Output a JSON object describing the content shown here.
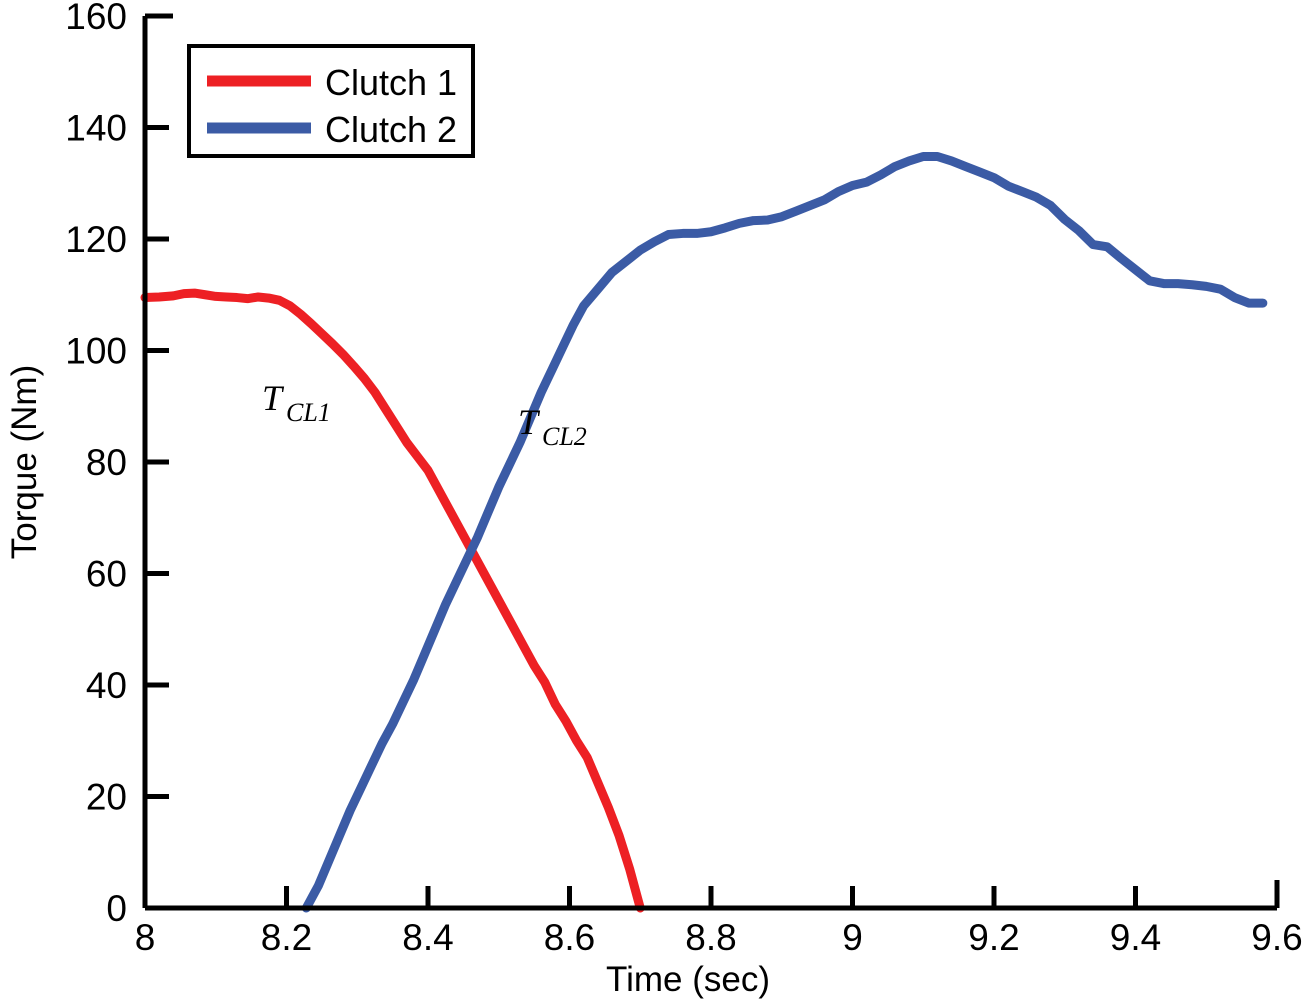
{
  "chart_data": {
    "type": "line",
    "title": "",
    "xlabel": "Time (sec)",
    "ylabel": "Torque (Nm)",
    "xlim": [
      8,
      9.6
    ],
    "ylim": [
      0,
      160
    ],
    "xticks": [
      "8",
      "8.2",
      "8.4",
      "8.6",
      "8.8",
      "9",
      "9.2",
      "9.4",
      "9.6"
    ],
    "xtick_values": [
      8,
      8.2,
      8.4,
      8.6,
      8.8,
      9,
      9.2,
      9.4,
      9.6
    ],
    "yticks": [
      "0",
      "20",
      "40",
      "60",
      "80",
      "100",
      "120",
      "140",
      "160"
    ],
    "ytick_values": [
      0,
      20,
      40,
      60,
      80,
      100,
      120,
      140,
      160
    ],
    "grid": false,
    "legend_position": "upper-left-inside",
    "legend": [
      {
        "name": "Clutch 1",
        "color": "#ED2024"
      },
      {
        "name": "Clutch 2",
        "color": "#3B5BA5"
      }
    ],
    "annotations": [
      {
        "text": "T",
        "sub": "CL1",
        "x": 8.23,
        "y": 93,
        "series": "Clutch 1"
      },
      {
        "text": "T",
        "sub": "CL2",
        "x": 8.55,
        "y": 86,
        "series": "Clutch 2"
      }
    ],
    "series": [
      {
        "name": "Clutch 1",
        "color": "#ED2024",
        "x": [
          8.0,
          8.02,
          8.04,
          8.055,
          8.07,
          8.085,
          8.1,
          8.115,
          8.13,
          8.145,
          8.16,
          8.175,
          8.19,
          8.205,
          8.22,
          8.235,
          8.25,
          8.265,
          8.28,
          8.295,
          8.31,
          8.325,
          8.34,
          8.355,
          8.37,
          8.385,
          8.4,
          8.415,
          8.43,
          8.445,
          8.46,
          8.475,
          8.49,
          8.505,
          8.52,
          8.535,
          8.55,
          8.565,
          8.58,
          8.595,
          8.61,
          8.625,
          8.64,
          8.655,
          8.67,
          8.685,
          8.7
        ],
        "y": [
          109.5,
          109.6,
          109.8,
          110.2,
          110.3,
          110.0,
          109.7,
          109.6,
          109.5,
          109.3,
          109.6,
          109.4,
          109.0,
          108.0,
          106.5,
          104.8,
          103.0,
          101.2,
          99.3,
          97.2,
          95.0,
          92.5,
          89.5,
          86.5,
          83.5,
          81.0,
          78.5,
          75.0,
          71.5,
          68.0,
          64.5,
          61.0,
          57.5,
          54.0,
          50.5,
          47.0,
          43.5,
          40.5,
          36.5,
          33.5,
          30.0,
          27.0,
          22.5,
          18.0,
          13.0,
          7.0,
          0.0
        ]
      },
      {
        "name": "Clutch 2",
        "color": "#3B5BA5",
        "x": [
          8.228,
          8.245,
          8.26,
          8.275,
          8.29,
          8.305,
          8.32,
          8.335,
          8.35,
          8.365,
          8.38,
          8.395,
          8.41,
          8.425,
          8.44,
          8.455,
          8.47,
          8.485,
          8.5,
          8.515,
          8.53,
          8.545,
          8.56,
          8.575,
          8.59,
          8.605,
          8.62,
          8.64,
          8.66,
          8.68,
          8.7,
          8.72,
          8.74,
          8.76,
          8.78,
          8.8,
          8.82,
          8.84,
          8.86,
          8.88,
          8.9,
          8.92,
          8.94,
          8.96,
          8.98,
          9.0,
          9.02,
          9.04,
          9.06,
          9.08,
          9.1,
          9.12,
          9.14,
          9.16,
          9.18,
          9.2,
          9.22,
          9.24,
          9.26,
          9.28,
          9.3,
          9.32,
          9.34,
          9.36,
          9.38,
          9.4,
          9.42,
          9.44,
          9.46,
          9.48,
          9.5,
          9.52,
          9.54,
          9.56,
          9.58
        ],
        "y": [
          0.0,
          4.0,
          8.5,
          13.0,
          17.5,
          21.5,
          25.5,
          29.5,
          33.0,
          37.0,
          41.0,
          45.5,
          50.0,
          54.5,
          58.5,
          62.5,
          66.5,
          71.0,
          75.5,
          79.5,
          83.5,
          88.0,
          92.5,
          96.5,
          100.5,
          104.5,
          108.0,
          111.0,
          114.0,
          116.0,
          118.0,
          119.5,
          120.8,
          121.0,
          121.0,
          121.3,
          122.0,
          122.8,
          123.3,
          123.4,
          124.0,
          125.0,
          126.0,
          127.0,
          128.5,
          129.6,
          130.2,
          131.5,
          133.0,
          134.0,
          134.8,
          134.8,
          134.0,
          133.0,
          132.0,
          131.0,
          129.5,
          128.5,
          127.5,
          126.0,
          123.5,
          121.5,
          119.0,
          118.6,
          116.5,
          114.5,
          112.5,
          112.0,
          112.0,
          111.8,
          111.5,
          111.0,
          109.5,
          108.5,
          108.5
        ]
      }
    ]
  }
}
